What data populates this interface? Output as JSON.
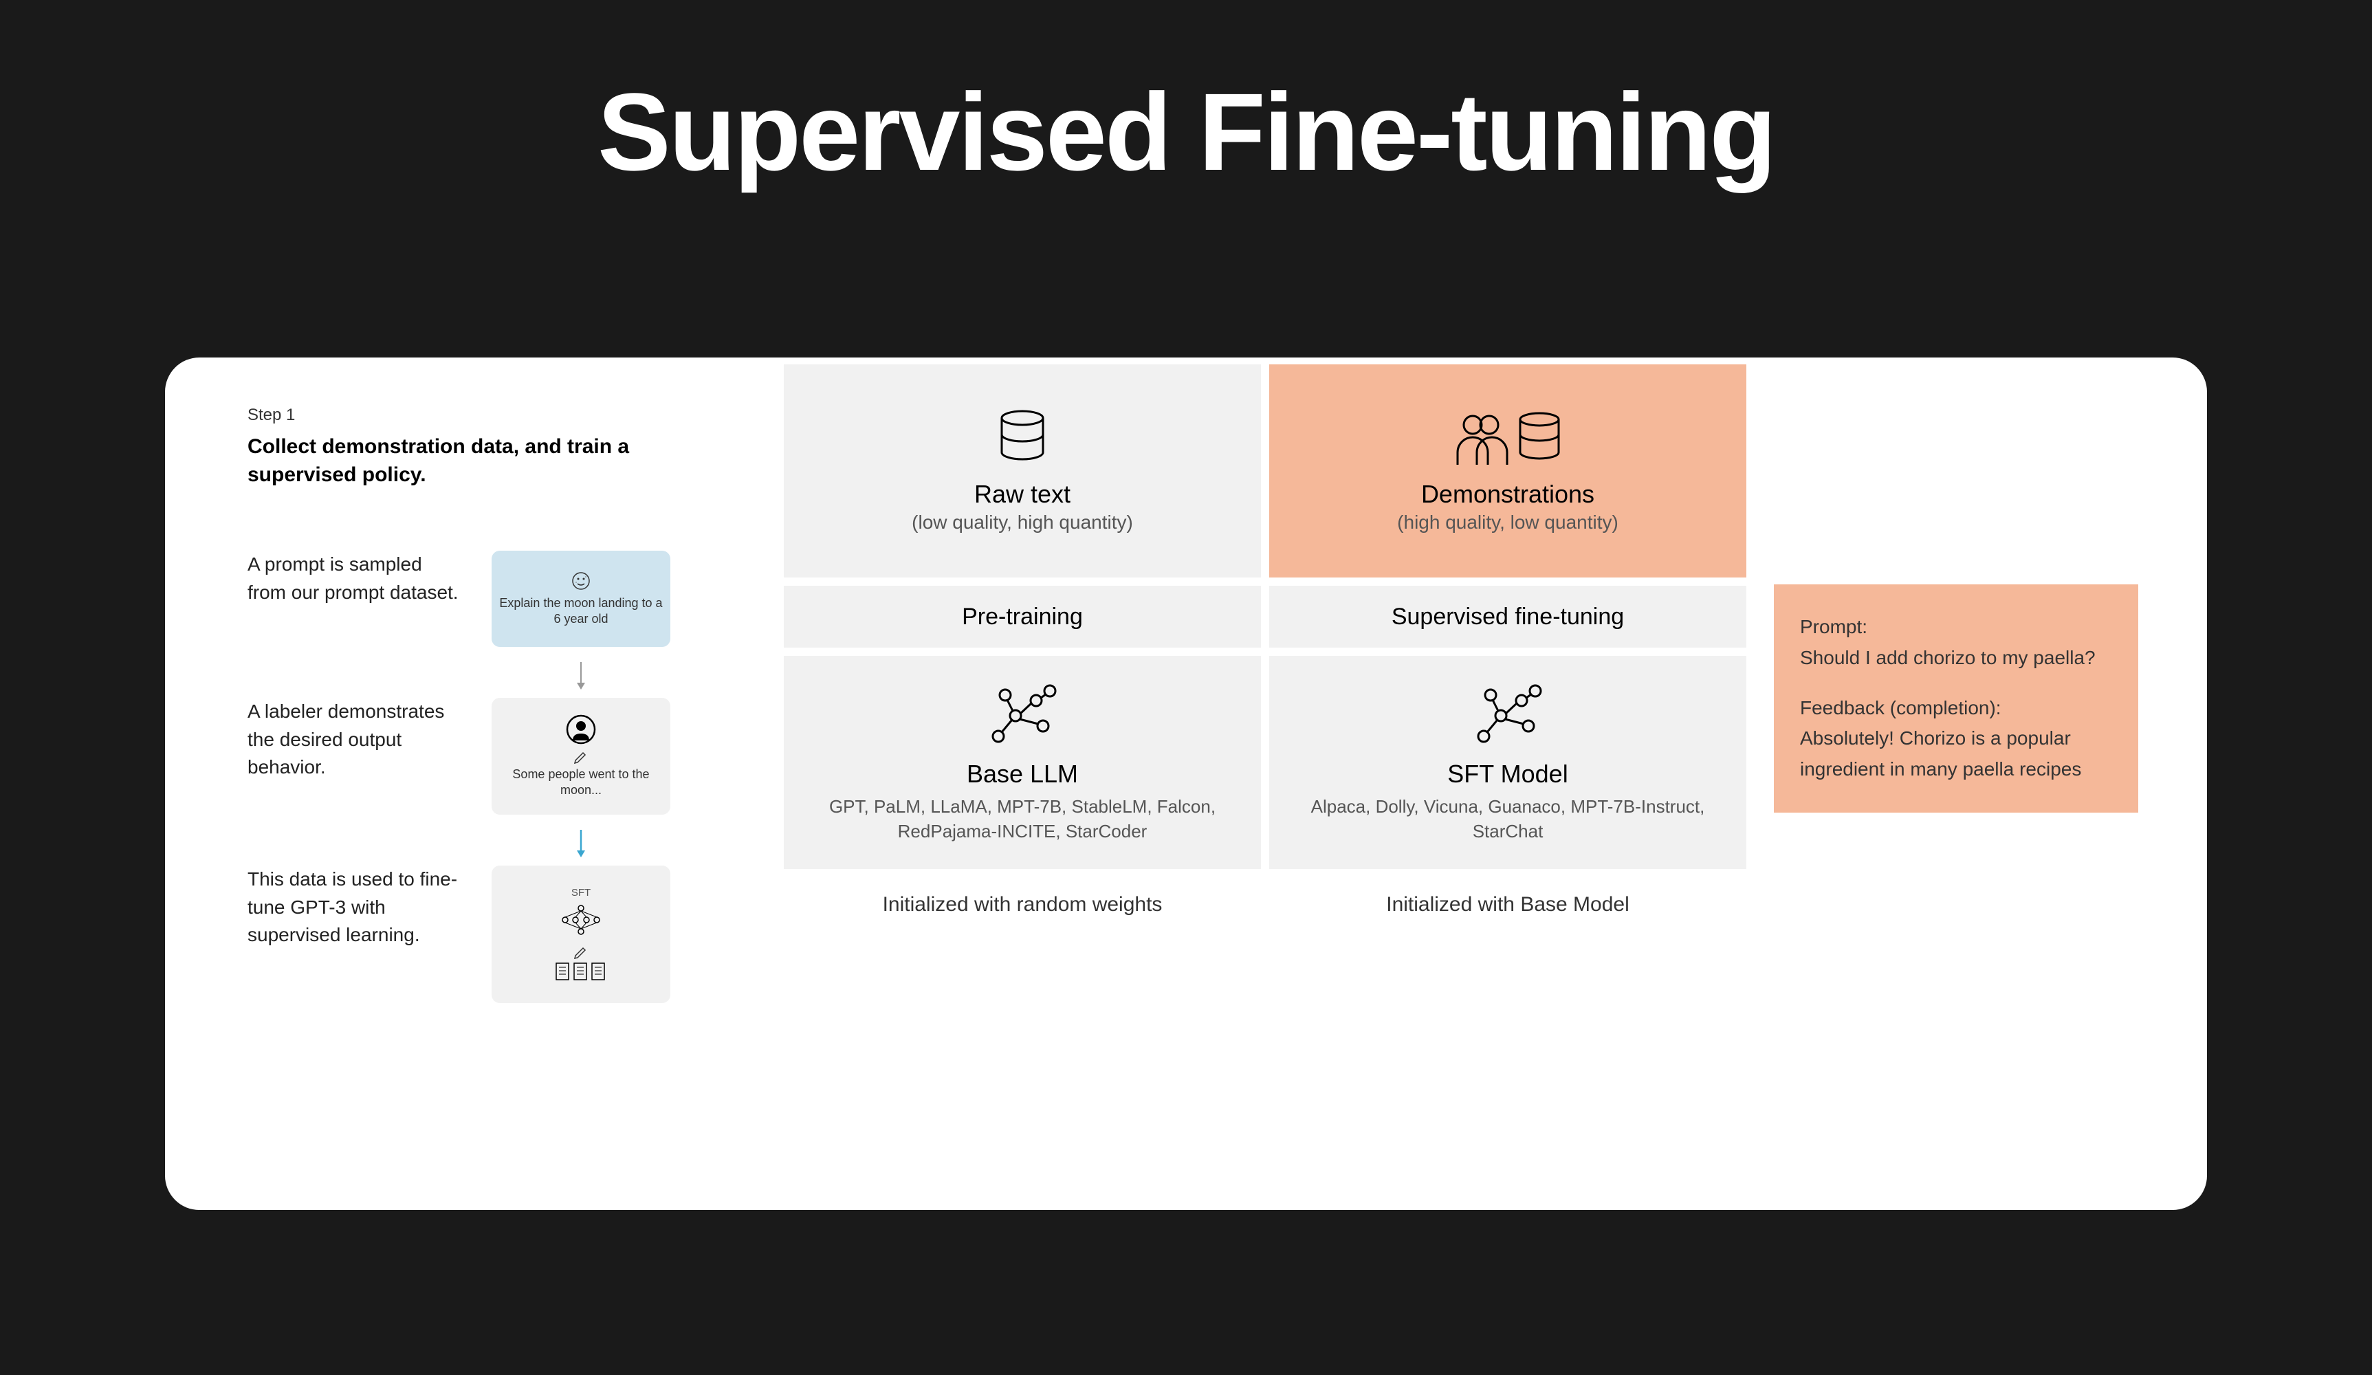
{
  "title": "Supervised Fine-tuning",
  "step": {
    "label": "Step 1",
    "title": "Collect demonstration data, and train a supervised policy.",
    "row1_text": "A prompt is sampled from our prompt dataset.",
    "row1_box": "Explain the moon landing to a 6 year old",
    "row2_text": "A labeler demonstrates the desired output behavior.",
    "row2_box": "Some people went to the moon...",
    "row3_text": "This data is used to fine-tune GPT-3 with supervised learning.",
    "row3_label": "SFT"
  },
  "grid": {
    "c1_title": "Raw text",
    "c1_sub": "(low quality, high quantity)",
    "c2_title": "Demonstrations",
    "c2_sub": "(high quality, low quantity)",
    "c3_label": "Pre-training",
    "c4_label": "Supervised fine-tuning",
    "c5_title": "Base LLM",
    "c5_list": "GPT, PaLM, LLaMA, MPT-7B, StableLM, Falcon, RedPajama-INCITE, StarCoder",
    "c6_title": "SFT Model",
    "c6_list": "Alpaca, Dolly, Vicuna, Guanaco, MPT-7B-Instruct, StarChat",
    "c7_text": "Initialized with random weights",
    "c8_text": "Initialized with Base Model"
  },
  "note": {
    "p1_label": "Prompt:",
    "p1_text": "Should I add chorizo to my paella?",
    "p2_label": "Feedback (completion):",
    "p2_text": "Absolutely! Chorizo is a popular ingredient in many paella recipes"
  }
}
